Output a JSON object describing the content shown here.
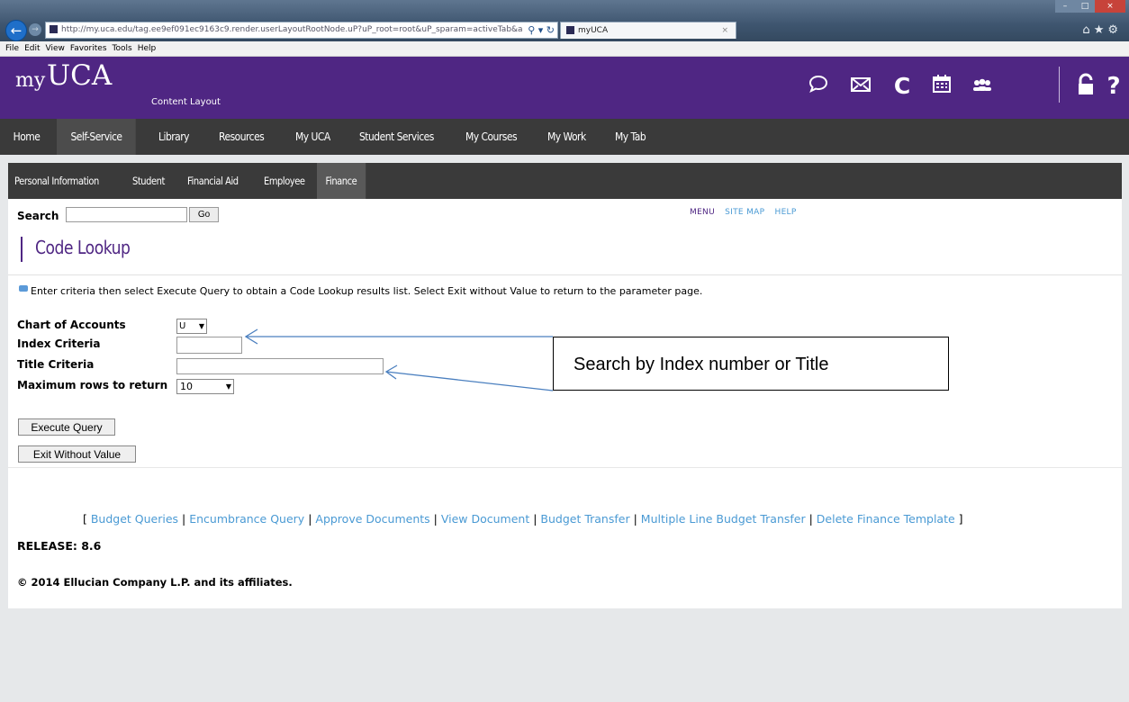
{
  "browser": {
    "url": "http://my.uca.edu/tag.ee9ef091ec9163c9.render.userLayoutRootNode.uP?uP_root=root&uP_sparam=activeTab&a",
    "tab_title": "myUCA",
    "menu": [
      "File",
      "Edit",
      "View",
      "Favorites",
      "Tools",
      "Help"
    ]
  },
  "portal": {
    "logo_my": "my",
    "logo_uca": "UCA",
    "subtitle": "Content Layout",
    "icons": [
      "chat-icon",
      "mail-icon",
      "campus-c-icon",
      "calendar-icon",
      "groups-icon",
      "lock-icon",
      "help-icon"
    ],
    "help_glyph": "?"
  },
  "main_nav": {
    "items": [
      "Home",
      "Self-Service",
      "Library",
      "Resources",
      "My UCA",
      "Student Services",
      "My Courses",
      "My Work",
      "My Tab"
    ],
    "active": "Self-Service"
  },
  "sub_nav": {
    "items": [
      "Personal Information",
      "Student",
      "Financial Aid",
      "Employee",
      "Finance"
    ],
    "active": "Finance"
  },
  "search": {
    "label": "Search",
    "go_label": "Go"
  },
  "top_links": {
    "menu": "MENU",
    "site_map": "SITE MAP",
    "help": "HELP"
  },
  "page": {
    "title": "Code Lookup",
    "info": "Enter criteria then select Execute Query to obtain a Code Lookup results list. Select Exit without Value to return to the parameter page."
  },
  "form": {
    "chart_label": "Chart of Accounts",
    "chart_value": "U",
    "index_label": "Index Criteria",
    "title_label": "Title Criteria",
    "max_label": "Maximum rows to return",
    "max_value": "10",
    "execute_label": "Execute Query",
    "exit_label": "Exit Without Value"
  },
  "bottom_links": [
    "Budget Queries",
    "Encumbrance Query",
    "Approve Documents",
    "View Document",
    "Budget Transfer",
    "Multiple Line Budget Transfer",
    "Delete Finance Template"
  ],
  "footer": {
    "release": "RELEASE: 8.6",
    "copyright": "© 2014 Ellucian Company L.P. and its affiliates."
  },
  "callout": "Search by Index number or Title",
  "colors": {
    "brand_purple": "#4f2683",
    "nav_dark": "#3a3a3a",
    "link_blue": "#4a9ad4"
  }
}
